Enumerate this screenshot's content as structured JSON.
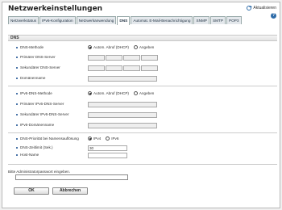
{
  "header": {
    "title": "Netzwerkeinstellungen",
    "refresh_label": "Aktualisieren",
    "help_label": "?"
  },
  "tabs": [
    {
      "label": "Netzwerkstatus"
    },
    {
      "label": "IPv6-Konfiguration"
    },
    {
      "label": "Netzwerkanwendung"
    },
    {
      "label": "DNS"
    },
    {
      "label": "Automat. E-Mail-Benachrichtigung"
    },
    {
      "label": "SNMP"
    },
    {
      "label": "SMTP"
    },
    {
      "label": "POP3"
    }
  ],
  "section": {
    "title": "DNS"
  },
  "dns": {
    "method_label": "DNS-Methode",
    "method_auto": "Autom. Abruf (DHCP)",
    "method_manual": "Angeben",
    "primary_label": "Primärer DNS-Server",
    "secondary_label": "Sekundärer DNS-Server",
    "domain_label": "Domänenname"
  },
  "ipv6": {
    "method_label": "IPv6-DNS-Methode",
    "method_auto": "Autom. Abruf (DHCP)",
    "method_manual": "Angeben",
    "primary_label": "Primärer IPv6-DNS-Server",
    "secondary_label": "Sekundärer IPv6-DNS-Server",
    "domain_label": "IPv6-Domänenname"
  },
  "misc": {
    "priority_label": "DNS-Priorität bei Namensauflösung",
    "priority_v4": "IPv4",
    "priority_v6": "IPv6",
    "timeout_label": "DNS-Zeitlimit (Sek.)",
    "timeout_value": "30",
    "hostname_label": "Host-Name",
    "hostname_value": ""
  },
  "admin": {
    "password_label": "Bitte Administratorpasswort eingeben.",
    "password_value": ""
  },
  "buttons": {
    "ok": "OK",
    "cancel": "Abbrechen"
  }
}
